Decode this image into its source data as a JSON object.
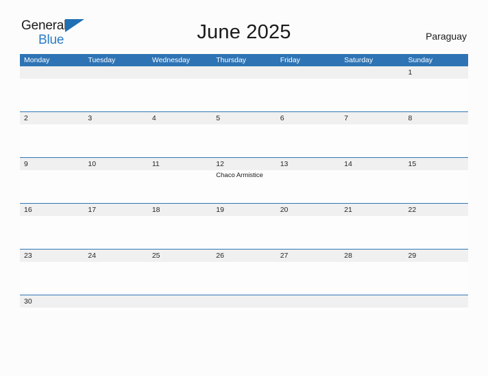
{
  "brand": {
    "name_part1": "General",
    "name_part2": "Blue",
    "triangle_icon": "blue-triangle-icon",
    "color_dark": "#1a1a1a",
    "color_blue": "#2b7cc4"
  },
  "header": {
    "title": "June 2025",
    "country": "Paraguay"
  },
  "colors": {
    "header_blue": "#2e74b5",
    "row_separator": "#2e74b5",
    "date_band": "#f0f0f0",
    "page_background": "#fcfcfc",
    "cell_background": "#fdfdfd",
    "text": "#242424"
  },
  "calendar": {
    "month": "June",
    "year": "2025",
    "weekday_headers": [
      "Monday",
      "Tuesday",
      "Wednesday",
      "Thursday",
      "Friday",
      "Saturday",
      "Sunday"
    ],
    "weeks": [
      {
        "days": [
          {
            "number": "",
            "events": []
          },
          {
            "number": "",
            "events": []
          },
          {
            "number": "",
            "events": []
          },
          {
            "number": "",
            "events": []
          },
          {
            "number": "",
            "events": []
          },
          {
            "number": "",
            "events": []
          },
          {
            "number": "1",
            "events": []
          }
        ]
      },
      {
        "days": [
          {
            "number": "2",
            "events": []
          },
          {
            "number": "3",
            "events": []
          },
          {
            "number": "4",
            "events": []
          },
          {
            "number": "5",
            "events": []
          },
          {
            "number": "6",
            "events": []
          },
          {
            "number": "7",
            "events": []
          },
          {
            "number": "8",
            "events": []
          }
        ]
      },
      {
        "days": [
          {
            "number": "9",
            "events": []
          },
          {
            "number": "10",
            "events": []
          },
          {
            "number": "11",
            "events": []
          },
          {
            "number": "12",
            "events": [
              "Chaco Armistice"
            ]
          },
          {
            "number": "13",
            "events": []
          },
          {
            "number": "14",
            "events": []
          },
          {
            "number": "15",
            "events": []
          }
        ]
      },
      {
        "days": [
          {
            "number": "16",
            "events": []
          },
          {
            "number": "17",
            "events": []
          },
          {
            "number": "18",
            "events": []
          },
          {
            "number": "19",
            "events": []
          },
          {
            "number": "20",
            "events": []
          },
          {
            "number": "21",
            "events": []
          },
          {
            "number": "22",
            "events": []
          }
        ]
      },
      {
        "days": [
          {
            "number": "23",
            "events": []
          },
          {
            "number": "24",
            "events": []
          },
          {
            "number": "25",
            "events": []
          },
          {
            "number": "26",
            "events": []
          },
          {
            "number": "27",
            "events": []
          },
          {
            "number": "28",
            "events": []
          },
          {
            "number": "29",
            "events": []
          }
        ]
      },
      {
        "short": true,
        "days": [
          {
            "number": "30",
            "events": []
          },
          {
            "number": "",
            "events": []
          },
          {
            "number": "",
            "events": []
          },
          {
            "number": "",
            "events": []
          },
          {
            "number": "",
            "events": []
          },
          {
            "number": "",
            "events": []
          },
          {
            "number": "",
            "events": []
          }
        ]
      }
    ]
  }
}
